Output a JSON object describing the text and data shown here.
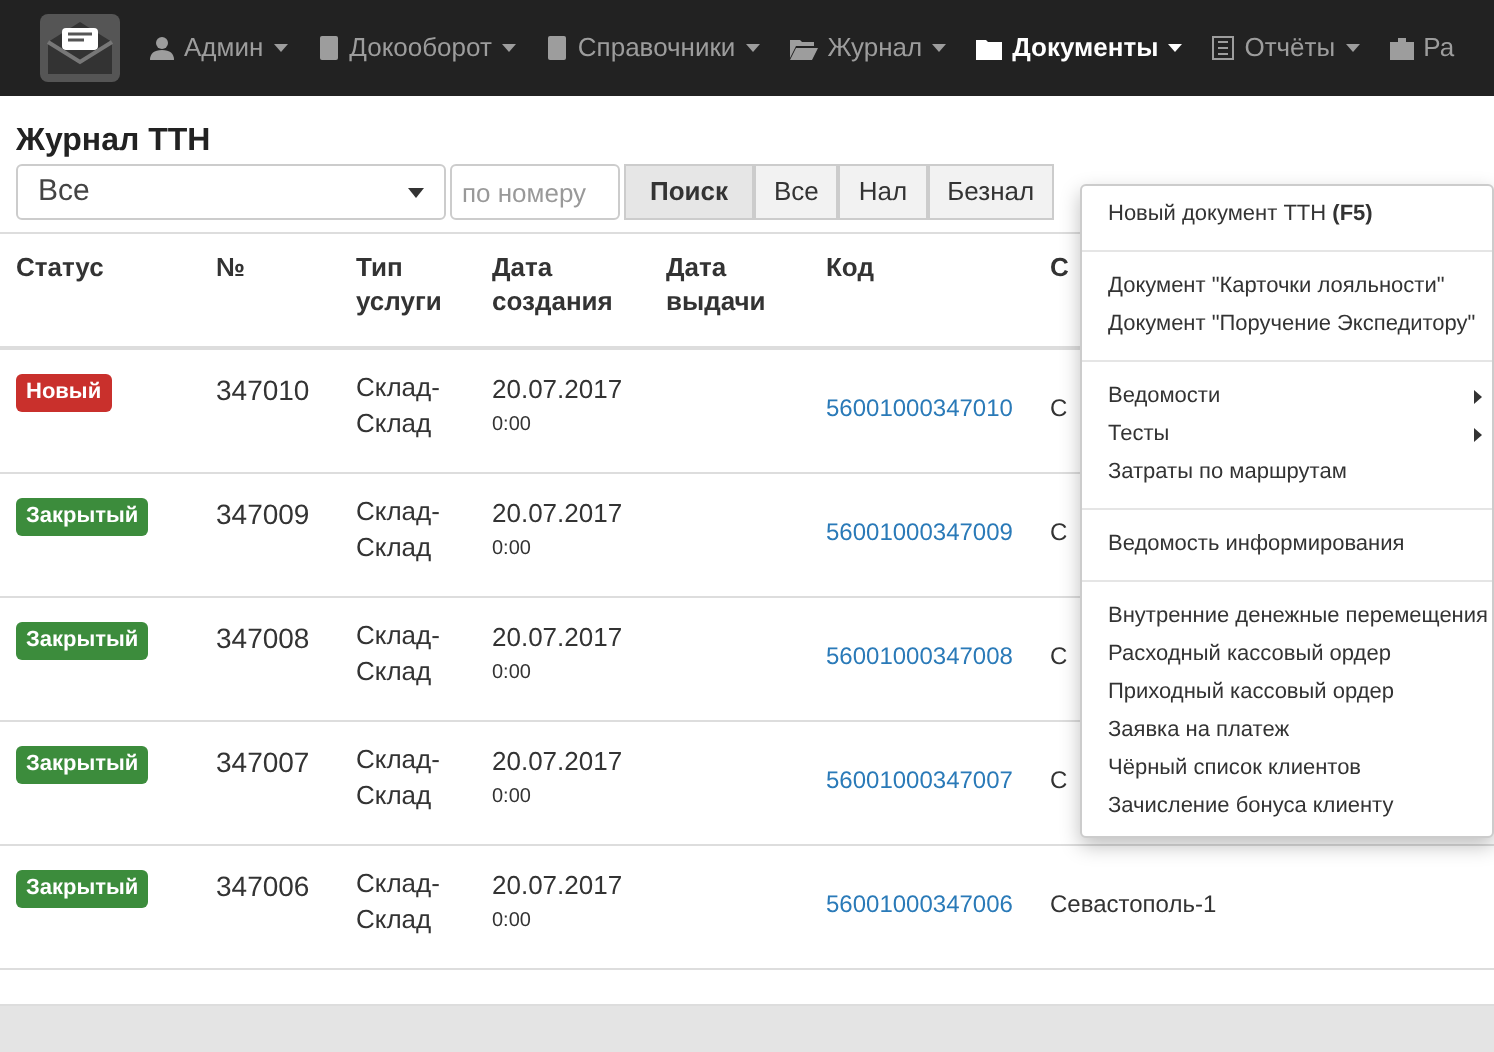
{
  "navbar": {
    "items": [
      {
        "label": "Админ",
        "caret": true,
        "selected": false
      },
      {
        "label": "Докооборот",
        "caret": true,
        "selected": false
      },
      {
        "label": "Справочники",
        "caret": true,
        "selected": false
      },
      {
        "label": "Журнал",
        "caret": true,
        "selected": false
      },
      {
        "label": "Документы",
        "caret": true,
        "selected": true
      },
      {
        "label": "Отчёты",
        "caret": true,
        "selected": false
      },
      {
        "label": "Ра",
        "caret": false,
        "selected": false
      }
    ]
  },
  "page_title": "Журнал ТТН",
  "filter": {
    "select_value": "Все",
    "search_placeholder": "по номеру",
    "buttons": [
      {
        "label": "Поиск",
        "selected": true
      },
      {
        "label": "Все",
        "selected": false
      },
      {
        "label": "Нал",
        "selected": false
      },
      {
        "label": "Безнал",
        "selected": false
      }
    ]
  },
  "table": {
    "columns": [
      "Статус",
      "№",
      "Тип услуги",
      "Дата создания",
      "Дата выдачи",
      "Код",
      "С"
    ],
    "rows": [
      {
        "status": "Новый",
        "kind": "new",
        "number": "347010",
        "service": "Склад-Склад",
        "created_date": "20.07.2017",
        "created_time": "0:00",
        "code": "56001000347010",
        "column_7": "С"
      },
      {
        "status": "Закрытый",
        "kind": "closed",
        "number": "347009",
        "service": "Склад-Склад",
        "created_date": "20.07.2017",
        "created_time": "0:00",
        "code": "56001000347009",
        "column_7": "С"
      },
      {
        "status": "Закрытый",
        "kind": "closed",
        "number": "347008",
        "service": "Склад-Склад",
        "created_date": "20.07.2017",
        "created_time": "0:00",
        "code": "56001000347008",
        "column_7": "С"
      },
      {
        "status": "Закрытый",
        "kind": "closed",
        "number": "347007",
        "service": "Склад-Склад",
        "created_date": "20.07.2017",
        "created_time": "0:00",
        "code": "56001000347007",
        "column_7": "С"
      },
      {
        "status": "Закрытый",
        "kind": "closed",
        "number": "347006",
        "service": "Склад-Склад",
        "created_date": "20.07.2017",
        "created_time": "0:00",
        "code": "56001000347006",
        "column_7": "Севастополь-1"
      }
    ]
  },
  "dropdown": {
    "groups": [
      [
        {
          "label": "Новый документ ТТН **(F5)**",
          "submenu": false
        }
      ],
      [
        {
          "label": "Документ \"Карточки лояльности\"",
          "submenu": false
        },
        {
          "label": "Документ \"Поручение Экспедитору\"",
          "submenu": false
        }
      ],
      [
        {
          "label": "Ведомости",
          "submenu": true
        },
        {
          "label": "Тесты",
          "submenu": true
        },
        {
          "label": "Затраты по маршрутам",
          "submenu": false
        }
      ],
      [
        {
          "label": "Ведомость информирования",
          "submenu": false
        }
      ],
      [
        {
          "label": "Внутренние денежные перемещения",
          "submenu": false
        },
        {
          "label": "Расходный кассовый ордер",
          "submenu": false
        },
        {
          "label": "Приходный кассовый ордер",
          "submenu": false
        },
        {
          "label": "Заявка на платеж",
          "submenu": false
        },
        {
          "label": "Чёрный список клиентов",
          "submenu": false
        },
        {
          "label": "Зачисление бонуса клиенту",
          "submenu": false
        }
      ]
    ]
  }
}
